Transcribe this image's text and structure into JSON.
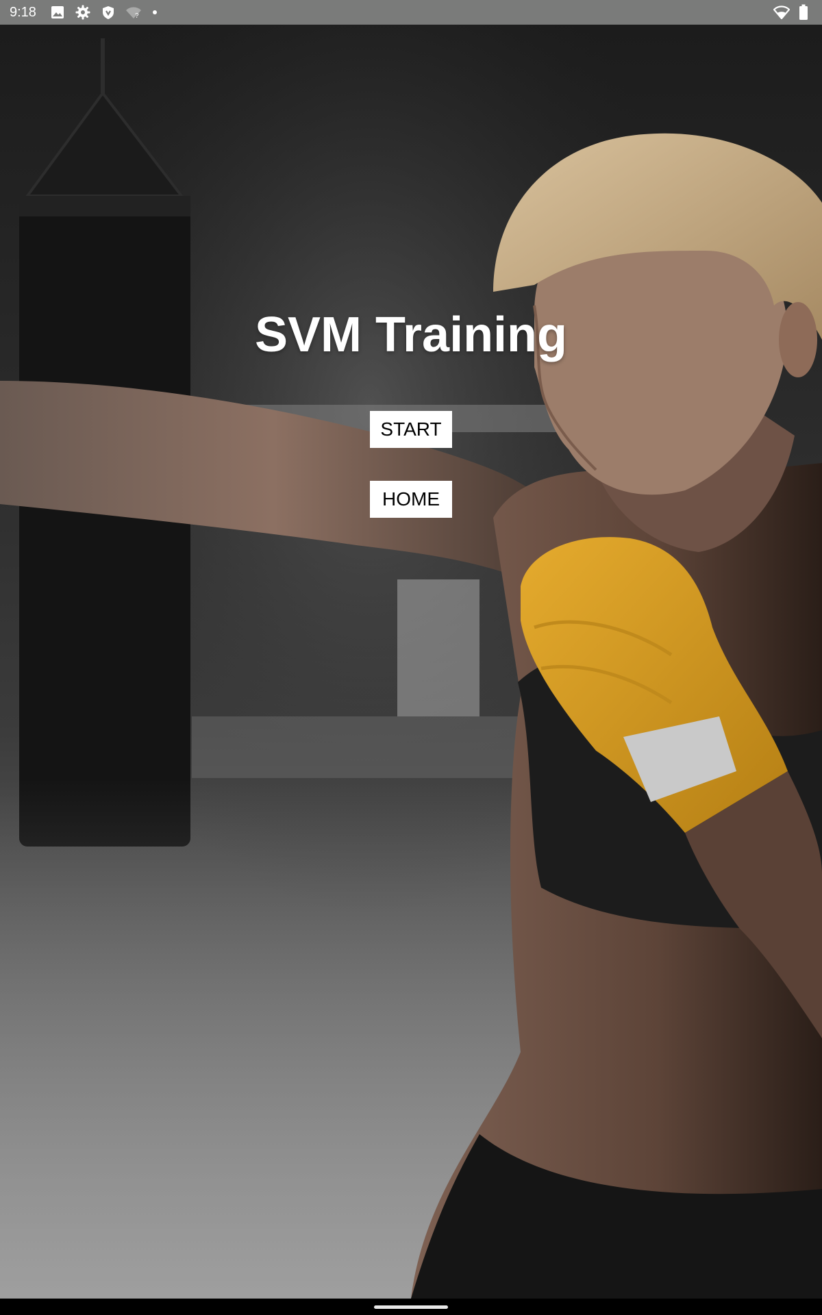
{
  "status_bar": {
    "time": "9:18",
    "left_icons": [
      "image-icon",
      "gear-icon",
      "shield-icon",
      "wifi-question-icon",
      "dot-icon"
    ],
    "right_icons": [
      "wifi-icon",
      "battery-icon"
    ]
  },
  "app": {
    "title": "SVM Training",
    "start_label": "START",
    "home_label": "HOME"
  },
  "colors": {
    "status_bar_bg": "#7a7b7a",
    "title_text": "#ffffff",
    "button_bg": "#ffffff",
    "button_text": "#000000",
    "nav_bar_bg": "#000000",
    "wrap_color": "#e0a52a"
  }
}
